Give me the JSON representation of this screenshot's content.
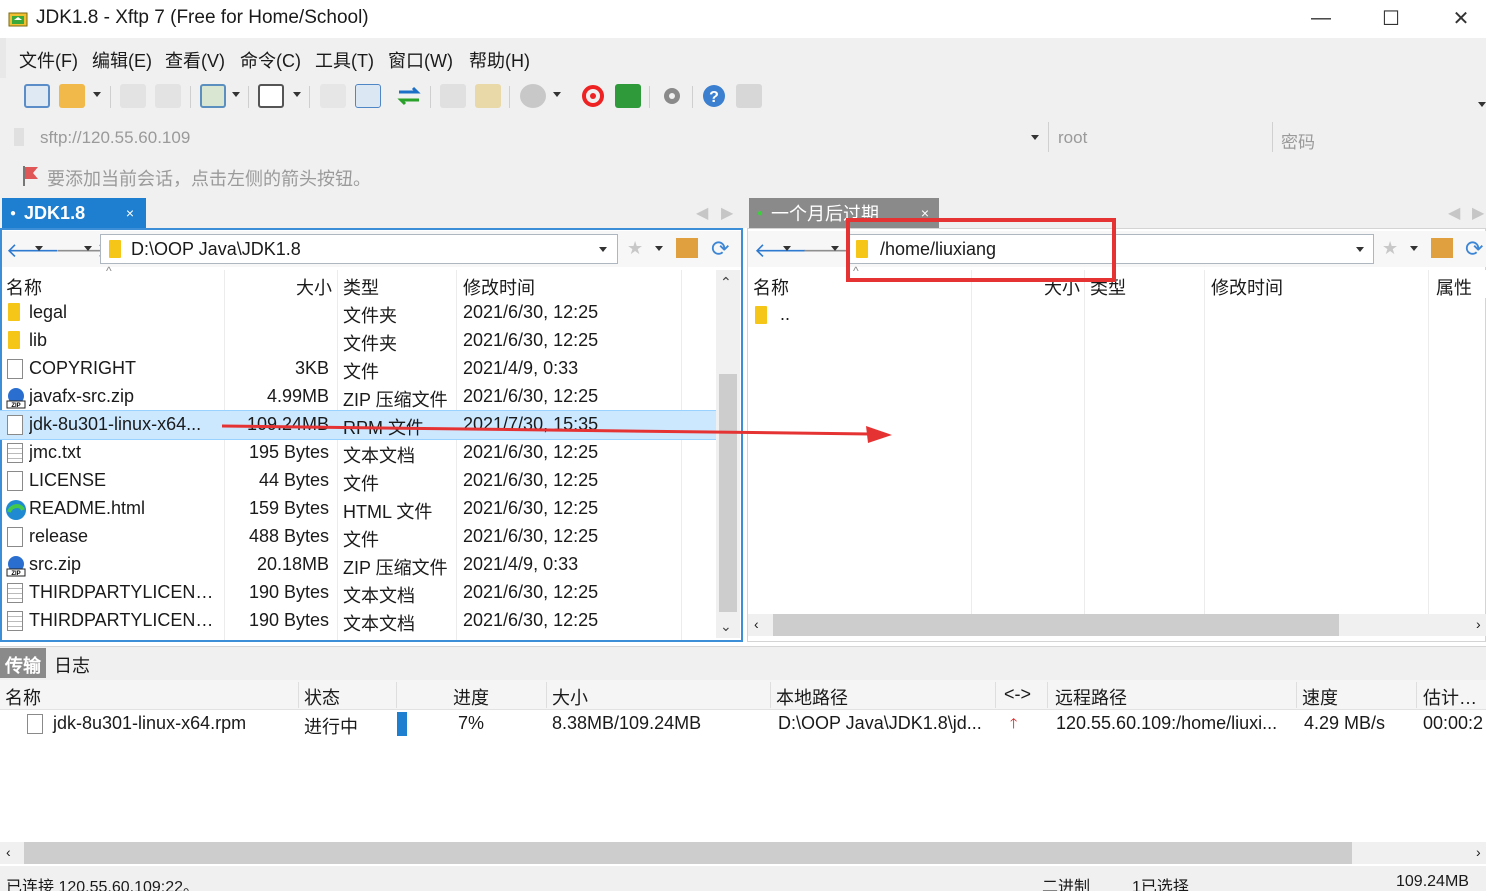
{
  "window": {
    "title": "JDK1.8 - Xftp 7 (Free for Home/School)",
    "minimize_glyph": "—",
    "maximize_glyph": "☐",
    "close_glyph": "✕"
  },
  "menu": [
    "文件(F)",
    "编辑(E)",
    "查看(V)",
    "命令(C)",
    "工具(T)",
    "窗口(W)",
    "帮助(H)"
  ],
  "address": {
    "host_placeholder": "sftp://120.55.60.109",
    "user_placeholder": "root",
    "password_placeholder": "密码"
  },
  "hint": "要添加当前会话，点击左侧的箭头按钮。",
  "tabs": {
    "left": "JDK1.8",
    "right": "一个月后过期",
    "close_glyph": "×"
  },
  "left_pane": {
    "path": "D:\\OOP Java\\JDK1.8",
    "columns": {
      "name": "名称",
      "size": "大小",
      "type": "类型",
      "modified": "修改时间"
    },
    "files": [
      {
        "name": "legal",
        "size": "",
        "type": "文件夹",
        "modified": "2021/6/30, 12:25",
        "icon": "folder-icon"
      },
      {
        "name": "lib",
        "size": "",
        "type": "文件夹",
        "modified": "2021/6/30, 12:25",
        "icon": "folder-icon"
      },
      {
        "name": "COPYRIGHT",
        "size": "3KB",
        "type": "文件",
        "modified": "2021/4/9, 0:33",
        "icon": "file-icon"
      },
      {
        "name": "javafx-src.zip",
        "size": "4.99MB",
        "type": "ZIP 压缩文件",
        "modified": "2021/6/30, 12:25",
        "icon": "zip-icon"
      },
      {
        "name": "jdk-8u301-linux-x64...",
        "size": "109.24MB",
        "type": "RPM 文件",
        "modified": "2021/7/30, 15:35",
        "icon": "file-icon",
        "selected": true
      },
      {
        "name": "jmc.txt",
        "size": "195 Bytes",
        "type": "文本文档",
        "modified": "2021/6/30, 12:25",
        "icon": "text-file-icon"
      },
      {
        "name": "LICENSE",
        "size": "44 Bytes",
        "type": "文件",
        "modified": "2021/6/30, 12:25",
        "icon": "file-icon"
      },
      {
        "name": "README.html",
        "size": "159 Bytes",
        "type": "HTML 文件",
        "modified": "2021/6/30, 12:25",
        "icon": "edge-browser-icon"
      },
      {
        "name": "release",
        "size": "488 Bytes",
        "type": "文件",
        "modified": "2021/6/30, 12:25",
        "icon": "file-icon"
      },
      {
        "name": "src.zip",
        "size": "20.18MB",
        "type": "ZIP 压缩文件",
        "modified": "2021/4/9, 0:33",
        "icon": "zip-icon"
      },
      {
        "name": "THIRDPARTYLICENS...",
        "size": "190 Bytes",
        "type": "文本文档",
        "modified": "2021/6/30, 12:25",
        "icon": "text-file-icon"
      },
      {
        "name": "THIRDPARTYLICENS...",
        "size": "190 Bytes",
        "type": "文本文档",
        "modified": "2021/6/30, 12:25",
        "icon": "text-file-icon"
      }
    ]
  },
  "right_pane": {
    "path": "/home/liuxiang",
    "columns": {
      "name": "名称",
      "size": "大小",
      "type": "类型",
      "modified": "修改时间",
      "attr": "属性"
    },
    "files": [
      {
        "name": "..",
        "icon": "folder-icon"
      }
    ]
  },
  "transfer": {
    "tabs": [
      "传输",
      "日志"
    ],
    "columns": {
      "name": "名称",
      "status": "状态",
      "progress": "进度",
      "size": "大小",
      "local": "本地路径",
      "dir": "<->",
      "remote": "远程路径",
      "speed": "速度",
      "eta": "估计剩余"
    },
    "rows": [
      {
        "name": "jdk-8u301-linux-x64.rpm",
        "status": "进行中",
        "progress_label": "7%",
        "progress": 0.07,
        "size": "8.38MB/109.24MB",
        "local": "D:\\OOP Java\\JDK1.8\\jd...",
        "remote": "120.55.60.109:/home/liuxi...",
        "speed": "4.29 MB/s",
        "eta": "00:00:2"
      }
    ]
  },
  "status": {
    "connection": "已连接 120.55.60.109:22。",
    "mode": "二进制",
    "selection": "1已选择",
    "size": "109.24MB"
  },
  "colors": {
    "accent_blue": "#1e7fd0",
    "annotation_red": "#e53333",
    "selection_bg": "#cce8ff",
    "active_tab": "#1e7fd0",
    "inactive_tab": "#8a8a8a"
  }
}
